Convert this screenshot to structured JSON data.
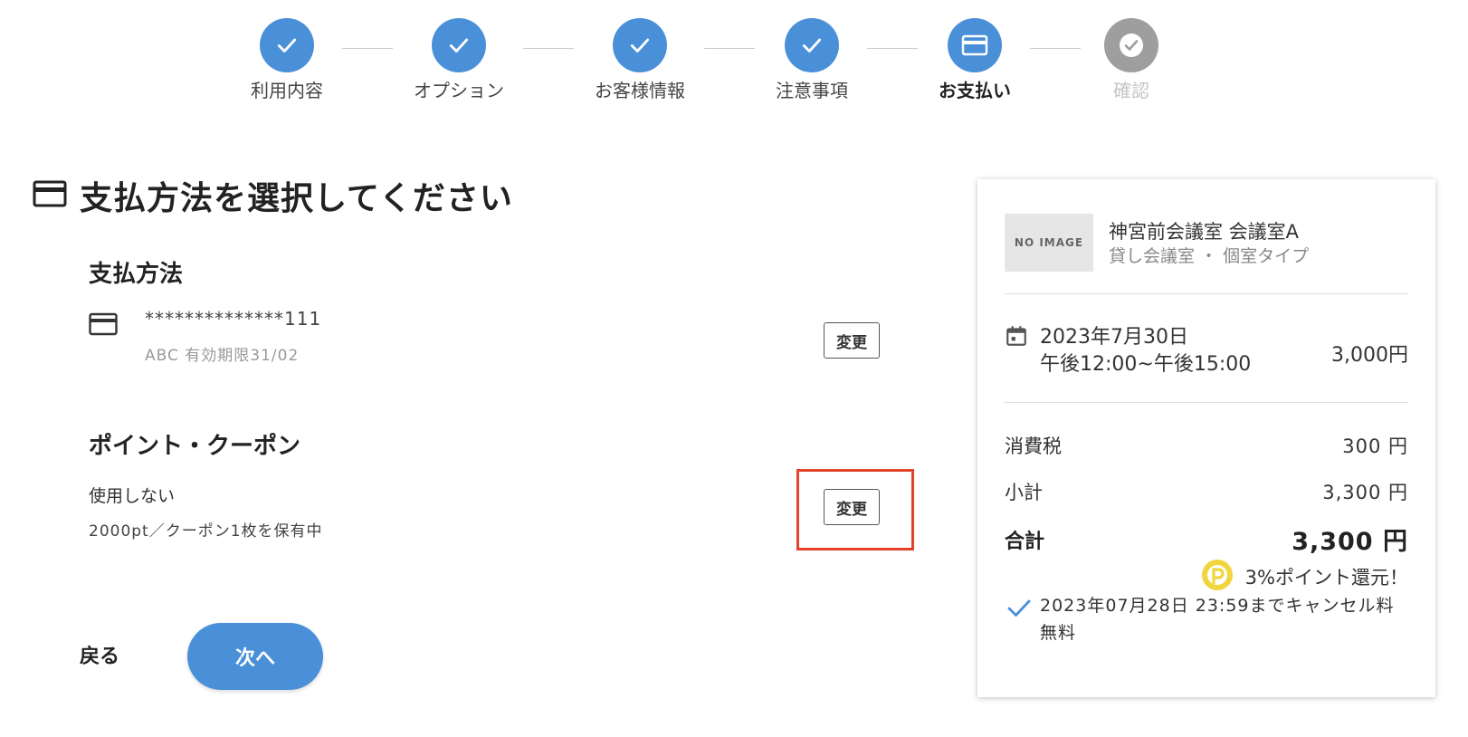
{
  "stepper": {
    "steps": [
      {
        "label": "利用内容",
        "state": "done"
      },
      {
        "label": "オプション",
        "state": "done"
      },
      {
        "label": "お客様情報",
        "state": "done"
      },
      {
        "label": "注意事項",
        "state": "done"
      },
      {
        "label": "お支払い",
        "state": "active"
      },
      {
        "label": "確認",
        "state": "pending"
      }
    ]
  },
  "page": {
    "title": "支払方法を選択してください"
  },
  "payment": {
    "heading": "支払方法",
    "card_number": "**************111",
    "card_meta": "ABC 有効期限31/02",
    "change_label": "変更",
    "icon": "credit-card-icon"
  },
  "coupon": {
    "heading": "ポイント・クーポン",
    "status": "使用しない",
    "info": "2000pt／クーポン1枚を保有中",
    "change_label": "変更"
  },
  "nav": {
    "back_label": "戻る",
    "next_label": "次へ"
  },
  "summary": {
    "thumb_text": "NO IMAGE",
    "space_name": "神宮前会議室 会議室A",
    "space_type": "貸し会議室 ・ 個室タイプ",
    "date": "2023年7月30日",
    "time": "午後12:00~午後15:00",
    "base_price": "3,000円",
    "tax_label": "消費税",
    "tax_value": "300 円",
    "subtotal_label": "小計",
    "subtotal_value": "3,300 円",
    "total_label": "合計",
    "total_value": "3,300 円",
    "points_text": "3%ポイント還元！",
    "cancel_text": "2023年07月28日 23:59までキャンセル料無料"
  },
  "colors": {
    "primary": "#4a90d9",
    "pending": "#9e9e9e",
    "highlight": "#e2432a",
    "points": "#f2d53c"
  }
}
